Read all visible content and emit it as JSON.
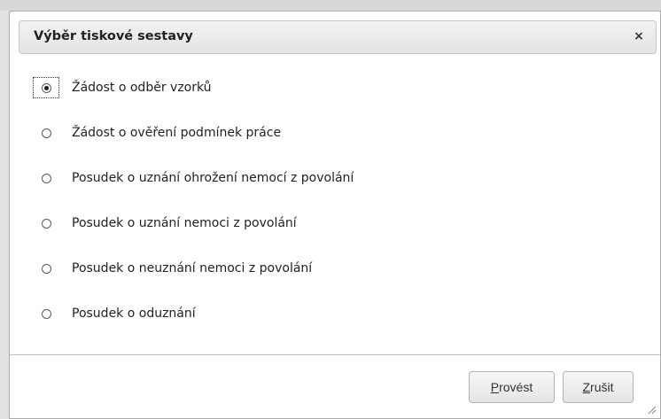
{
  "dialog": {
    "title": "Výběr tiskové sestavy",
    "close_glyph": "×",
    "close_icon": "close-icon"
  },
  "options": [
    {
      "label": "Žádost o odběr vzorků",
      "selected": true
    },
    {
      "label": "Žádost o ověření podmínek práce",
      "selected": false
    },
    {
      "label": "Posudek o uznání ohrožení nemocí z povolání",
      "selected": false
    },
    {
      "label": "Posudek o uznání nemoci z povolání",
      "selected": false
    },
    {
      "label": "Posudek o neuznání nemoci z povolání",
      "selected": false
    },
    {
      "label": "Posudek o oduznání",
      "selected": false
    }
  ],
  "buttons": {
    "run": {
      "accesskey": "P",
      "rest": "rovést"
    },
    "cancel": {
      "accesskey": "Z",
      "rest": "rušit"
    }
  },
  "colors": {
    "titlebar": "#e8e8e8",
    "border": "#aaaaaa",
    "text": "#222222"
  }
}
